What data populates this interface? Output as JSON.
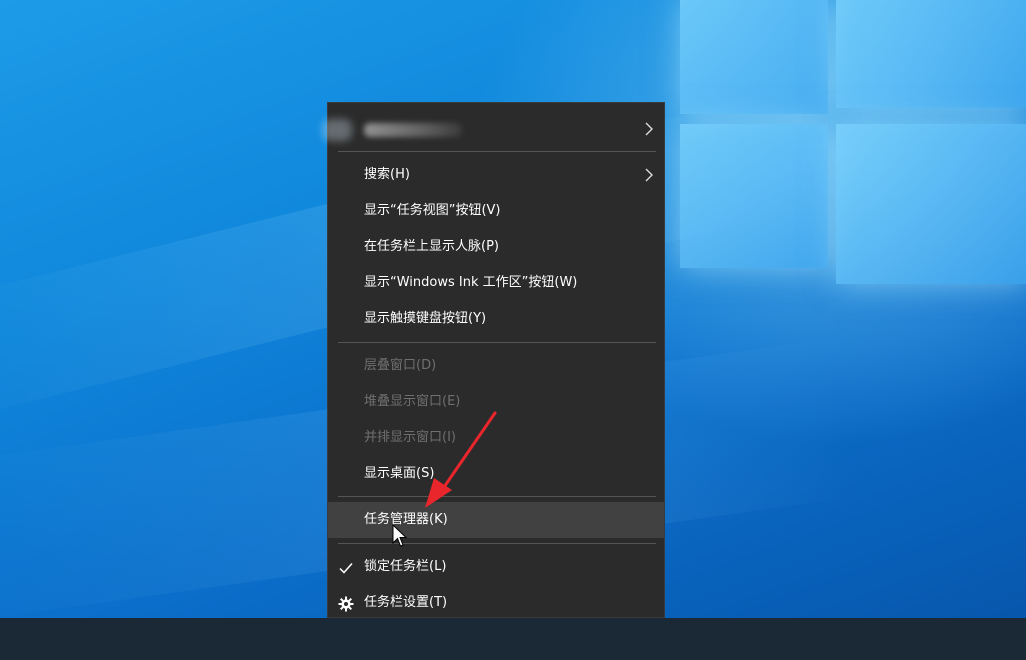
{
  "menu": {
    "items": [
      {
        "label": "",
        "submenu": true
      },
      {
        "label": "搜索(H)",
        "submenu": true
      },
      {
        "label": "显示“任务视图”按钮(V)"
      },
      {
        "label": "在任务栏上显示人脉(P)"
      },
      {
        "label": "显示“Windows Ink 工作区”按钮(W)"
      },
      {
        "label": "显示触摸键盘按钮(Y)"
      },
      {
        "label": "层叠窗口(D)",
        "disabled": true
      },
      {
        "label": "堆叠显示窗口(E)",
        "disabled": true
      },
      {
        "label": "并排显示窗口(I)",
        "disabled": true
      },
      {
        "label": "显示桌面(S)"
      },
      {
        "label": "任务管理器(K)",
        "highlighted": true
      },
      {
        "label": "锁定任务栏(L)",
        "icon": "check-icon",
        "checked": true
      },
      {
        "label": "任务栏设置(T)",
        "icon": "gear-icon"
      }
    ]
  },
  "annotation": {
    "color": "#e8262b"
  },
  "colors": {
    "menu_bg": "#2b2b2b",
    "highlight": "#414141",
    "taskbar": "#1b2936",
    "desktop": "#0f86db"
  }
}
